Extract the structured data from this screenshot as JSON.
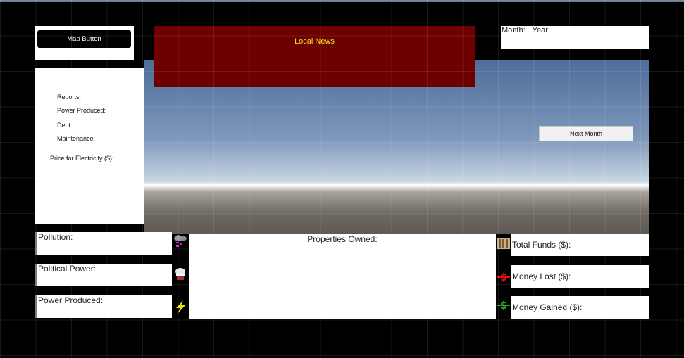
{
  "header": {
    "map_button_label": "Map Button",
    "news_title": "Local News",
    "month_label": "Month:",
    "year_label": "Year:"
  },
  "reports_panel": {
    "reports_label": "Reports:",
    "power_produced_label": "Power Produced:",
    "debt_label": "Debt:",
    "maintenance_label": "Maintenance:",
    "price_label": "Price for Electricity ($):"
  },
  "next_month_label": "Next Month",
  "stats": {
    "pollution_label": "Pollution:",
    "political_power_label": "Political Power:",
    "power_produced_label": "Power Produced:"
  },
  "properties_label": "Properties Owned:",
  "finances": {
    "total_funds_label": "Total Funds ($):",
    "money_lost_label": "Money Lost ($):",
    "money_gained_label": "Money Gained ($):"
  },
  "icons": {
    "pollution": "cloud-icon",
    "political": "capitol-icon",
    "power": "lightning-icon",
    "funds": "cash-stack-icon",
    "lost": "money-lost-icon",
    "gained": "money-gained-icon"
  },
  "colors": {
    "news_bg": "#6e0000",
    "news_text": "#f0e020",
    "lost": "#e01010",
    "gained": "#2aa82a",
    "lightning": "#f2e400"
  }
}
